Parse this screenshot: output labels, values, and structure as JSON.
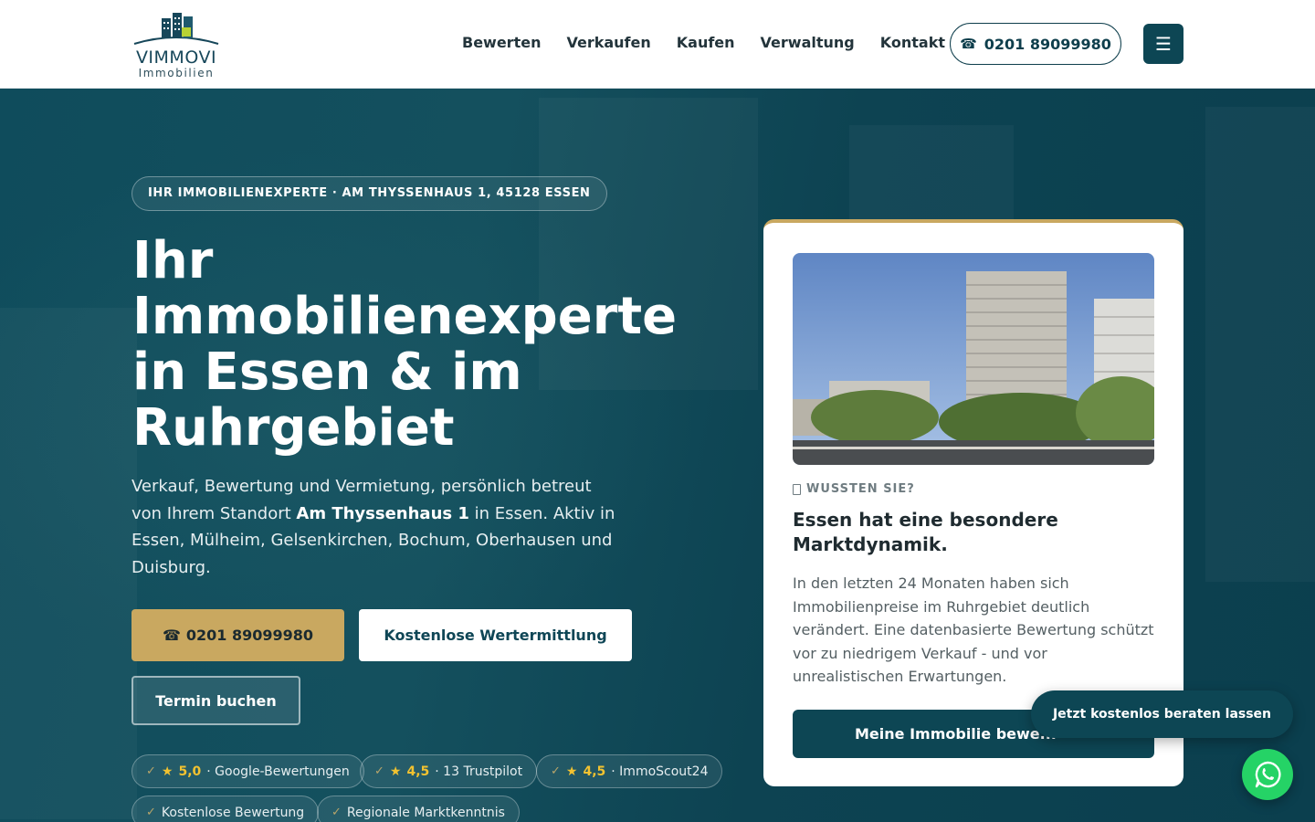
{
  "brand": {
    "name": "VIMMOVI",
    "sub": "Immobilien"
  },
  "nav": {
    "items": [
      "Bewerten",
      "Verkaufen",
      "Kaufen",
      "Verwaltung",
      "Kontakt"
    ],
    "phone": "0201 89099980",
    "menu_icon": "hamburger-icon"
  },
  "hero": {
    "badge": "IHR IMMOBILIENEXPERTE · AM THYSSENHAUS 1, 45128 ESSEN",
    "title": "Ihr Immobilienexperte in Essen & im Ruhrgebiet",
    "text_before": "Verkauf, Bewertung und Vermietung, persönlich betreut von Ihrem Standort ",
    "text_bold": "Am Thyssenhaus 1",
    "text_after": " in Essen. Aktiv in Essen, Mülheim, Gelsenkirchen, Bochum, Oberhausen und Duisburg.",
    "btn_phone": "0201 89099980",
    "btn_valuation": "Kostenlose Wertermittlung",
    "btn_appointment": "Termin buchen",
    "ratings": [
      {
        "score": "5,0",
        "source": "· Google-Bewertungen"
      },
      {
        "score": "4,5",
        "source": "· 13 Trustpilot"
      },
      {
        "score": "4,5",
        "source": "· ImmoScout24"
      }
    ],
    "features": [
      "Kostenlose Bewertung",
      "Regionale Marktkenntnis"
    ]
  },
  "card": {
    "eyebrow": "WUSSTEN SIE?",
    "title": "Essen hat eine besondere Marktdynamik.",
    "text": "In den letzten 24 Monaten haben sich Immobilienpreise im Ruhrgebiet deutlich verändert. Eine datenbasierte Bewertung schützt vor zu niedrigem Verkauf - und vor unrealistischen Erwartungen.",
    "button": "Meine Immobilie bewe..."
  },
  "floating": {
    "cta": "Jetzt kostenlos beraten lassen",
    "whatsapp_icon": "whatsapp-icon"
  },
  "colors": {
    "primary": "#0d4654",
    "gold": "#c9a860",
    "whatsapp": "#25d366"
  }
}
